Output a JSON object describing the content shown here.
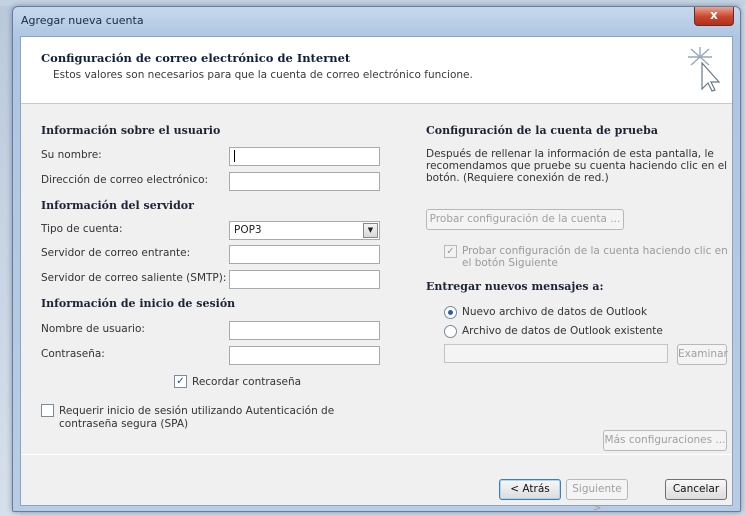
{
  "window": {
    "title": "Agregar nueva cuenta",
    "close_symbol": "x"
  },
  "header": {
    "title": "Configuración de correo electrónico de Internet",
    "subtitle": "Estos valores son necesarios para que la cuenta de correo electrónico funcione."
  },
  "user_info": {
    "heading": "Información sobre el usuario",
    "name_label": "Su nombre:",
    "name_value": "",
    "email_label": "Dirección de correo electrónico:",
    "email_value": ""
  },
  "server_info": {
    "heading": "Información del servidor",
    "account_type_label": "Tipo de cuenta:",
    "account_type_value": "POP3",
    "incoming_label": "Servidor de correo entrante:",
    "incoming_value": "",
    "outgoing_label": "Servidor de correo saliente (SMTP):",
    "outgoing_value": ""
  },
  "login_info": {
    "heading": "Información de inicio de sesión",
    "username_label": "Nombre de usuario:",
    "username_value": "",
    "password_label": "Contraseña:",
    "password_value": "",
    "remember_label": "Recordar contraseña",
    "remember_checked": true,
    "spa_label_line1": "Requerir inicio de sesión utilizando Autenticación de",
    "spa_label_line2": "contraseña segura (SPA)",
    "spa_checked": false
  },
  "test_settings": {
    "heading": "Configuración de la cuenta de prueba",
    "desc_line1": "Después de rellenar la información de esta pantalla, le",
    "desc_line2": "recomendamos que pruebe su cuenta haciendo clic en el",
    "desc_line3": "botón. (Requiere conexión de red.)",
    "test_button": "Probar configuración de la cuenta ...",
    "auto_test_line1": "Probar configuración de la cuenta haciendo clic en",
    "auto_test_line2": "el botón Siguiente"
  },
  "deliver": {
    "heading": "Entregar nuevos mensajes a:",
    "option_new": "Nuevo archivo de datos de Outlook",
    "option_existing": "Archivo de datos de Outlook existente",
    "existing_path": "",
    "browse_button": "Examinar"
  },
  "more_settings_button": "Más configuraciones ...",
  "footer": {
    "back_button": "< Atrás",
    "next_button": "Siguiente >",
    "cancel_button": "Cancelar"
  }
}
